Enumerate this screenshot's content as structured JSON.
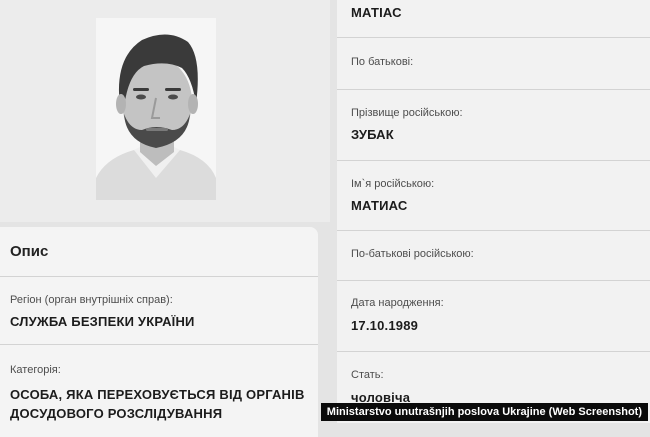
{
  "left": {
    "photo_icon": "person-photo",
    "description_title": "Опис",
    "region_label": "Регіон (орган внутрішніх справ):",
    "region_value": "СЛУЖБА БЕЗПЕКИ УКРАЇНИ",
    "category_label": "Категорія:",
    "category_line1": "ОСОБА, ЯКА ПЕРЕХОВУЄТЬСЯ ВІД ОРГАНІВ",
    "category_line2": "ДОСУДОВОГО РОЗСЛІДУВАННЯ"
  },
  "right": {
    "first_name_value": "МАТІАС",
    "patronymic_label": "По батькові:",
    "surname_ru_label": "Прізвище російською:",
    "surname_ru_value": "ЗУБАК",
    "first_name_ru_label": "Ім`я російською:",
    "first_name_ru_value": "МАТИАС",
    "patronymic_ru_label": "По-батькові російською:",
    "birthdate_label": "Дата народження:",
    "birthdate_value": "17.10.1989",
    "sex_label": "Стать:",
    "sex_value": "чоловіча"
  },
  "caption": "Ministarstvo unutrašnjih poslova Ukrajine (Web Screenshot)"
}
